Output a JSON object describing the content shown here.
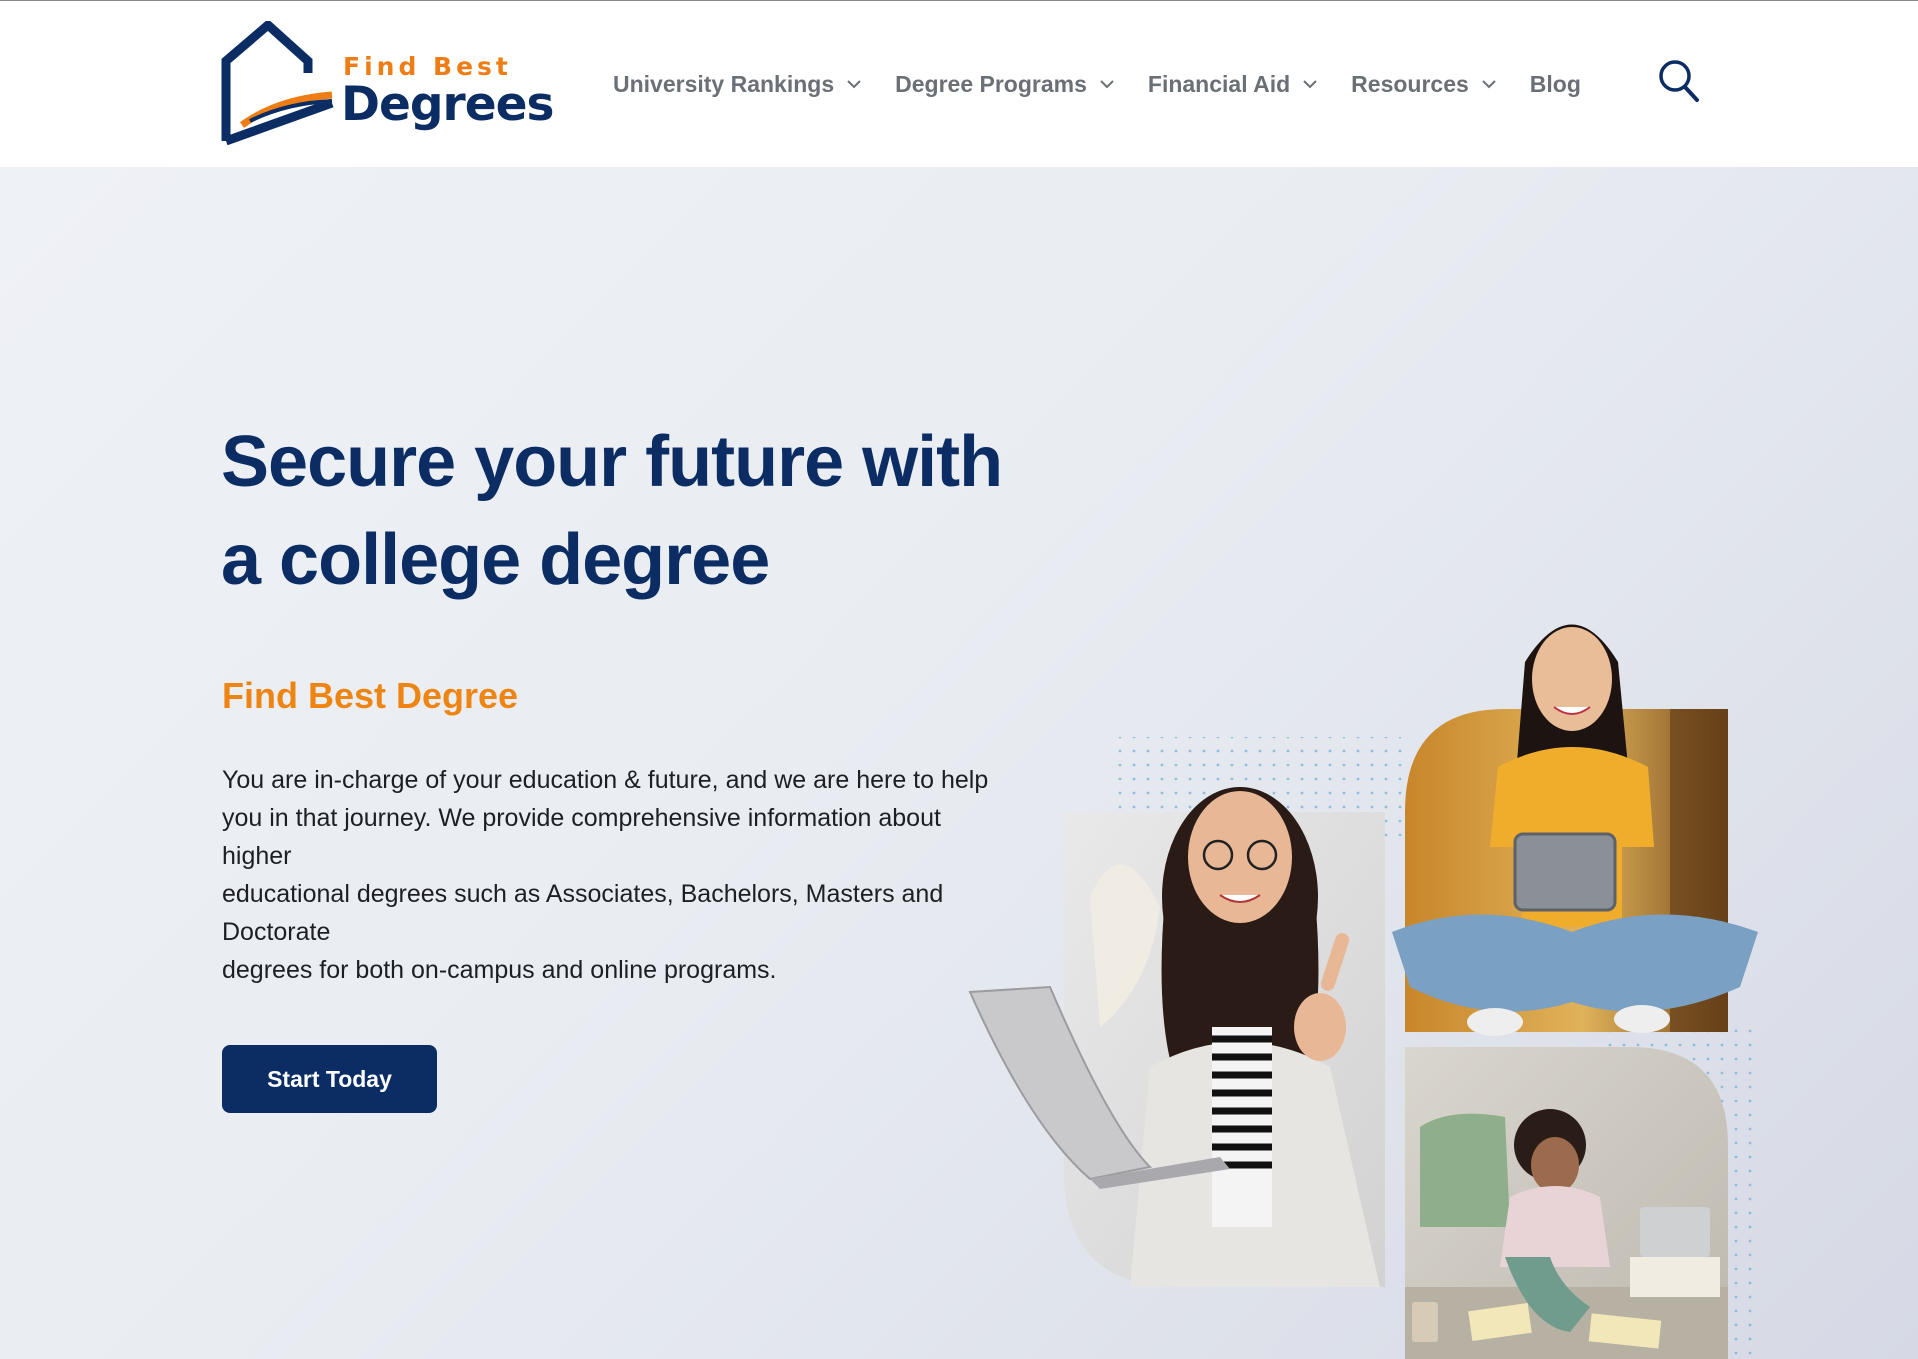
{
  "brand": {
    "name_top": "Find Best",
    "name_main": "Degrees",
    "colors": {
      "navy": "#0c2d63",
      "orange": "#ee7d16"
    }
  },
  "nav": {
    "items": [
      {
        "label": "University Rankings",
        "has_dropdown": true
      },
      {
        "label": "Degree Programs",
        "has_dropdown": true
      },
      {
        "label": "Financial Aid",
        "has_dropdown": true
      },
      {
        "label": "Resources",
        "has_dropdown": true
      },
      {
        "label": "Blog",
        "has_dropdown": false
      }
    ],
    "search_icon": "search-icon"
  },
  "hero": {
    "title_line1": "Secure your future with",
    "title_line2": "a college degree",
    "subtitle": "Find Best Degree",
    "body_lines": [
      "You are in-charge of your education & future, and we are here to help",
      "you in that journey. We provide comprehensive information about",
      "higher",
      "educational degrees such as Associates, Bachelors, Masters and",
      "Doctorate",
      "degrees for both on-campus and online programs."
    ],
    "cta_label": "Start Today"
  },
  "images": [
    {
      "name": "woman-with-laptop-photo"
    },
    {
      "name": "woman-with-tablet-photo"
    },
    {
      "name": "woman-studying-floor-photo"
    }
  ]
}
